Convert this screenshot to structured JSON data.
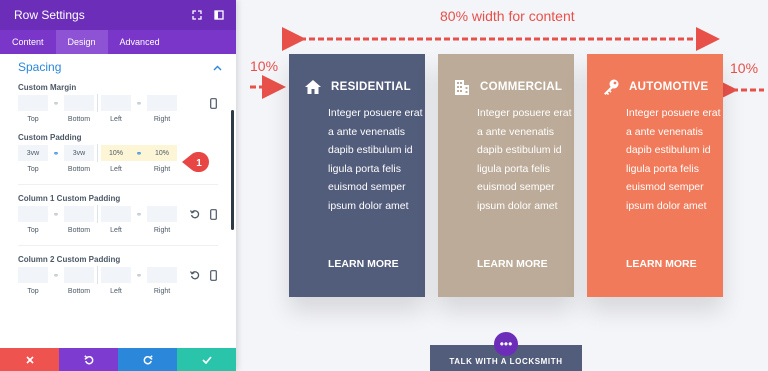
{
  "panel": {
    "title": "Row Settings",
    "tabs": [
      "Content",
      "Design",
      "Advanced"
    ],
    "section_title": "Spacing",
    "fields": {
      "custom_margin": {
        "label": "Custom Margin",
        "values": [
          "",
          "",
          "",
          ""
        ],
        "sublabels": [
          "Top",
          "Bottom",
          "Left",
          "Right"
        ]
      },
      "custom_padding": {
        "label": "Custom Padding",
        "values": [
          "3vw",
          "3vw",
          "10%",
          "10%"
        ],
        "sublabels": [
          "Top",
          "Bottom",
          "Left",
          "Right"
        ]
      },
      "col1_padding": {
        "label": "Column 1 Custom Padding",
        "values": [
          "",
          "",
          "",
          ""
        ],
        "sublabels": [
          "Top",
          "Bottom",
          "Left",
          "Right"
        ]
      },
      "col2_padding": {
        "label": "Column 2 Custom Padding",
        "values": [
          "",
          "",
          "",
          ""
        ],
        "sublabels": [
          "Top",
          "Bottom",
          "Left",
          "Right"
        ]
      }
    },
    "badge": "1"
  },
  "bottom_bar": {
    "colors": [
      "#ef5350",
      "#7e3bd0",
      "#2b87da",
      "#29c4a9"
    ],
    "icons": [
      "close-icon",
      "undo-icon",
      "redo-icon",
      "check-icon"
    ]
  },
  "annotations": {
    "top": "80% width for content",
    "left": "10%",
    "right": "10%"
  },
  "cards": [
    {
      "title": "RESIDENTIAL",
      "icon": "house-icon",
      "body": "Integer posuere erat a ante venenatis dapib estibulum id ligula porta felis euismod semper ipsum dolor amet",
      "link": "LEARN MORE",
      "color": "#525c7b"
    },
    {
      "title": "COMMERCIAL",
      "icon": "building-icon",
      "body": "Integer posuere erat a ante venenatis dapib estibulum id ligula porta felis euismod semper ipsum dolor amet",
      "link": "LEARN MORE",
      "color": "#bcab98"
    },
    {
      "title": "AUTOMOTIVE",
      "icon": "key-icon",
      "body": "Integer posuere erat a ante venenatis dapib estibulum id ligula porta felis euismod semper ipsum dolor amet",
      "link": "LEARN MORE",
      "color": "#f07a5a"
    }
  ],
  "cta": {
    "label": "TALK WITH A LOCKSMITH",
    "dots": "•••"
  }
}
